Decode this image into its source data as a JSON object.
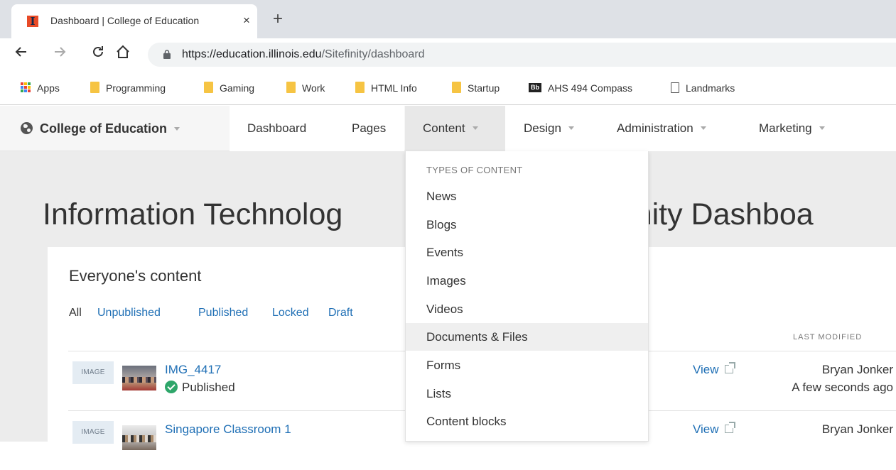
{
  "browser": {
    "tab_title": "Dashboard | College of Education",
    "tab_close": "×",
    "new_tab": "+",
    "url_host": "https://education.illinois.edu",
    "url_path": "/Sitefinity/dashboard"
  },
  "bookmarks": [
    {
      "label": "Apps",
      "icon": "apps-icon"
    },
    {
      "label": "Programming",
      "icon": "folder-icon"
    },
    {
      "label": "Gaming",
      "icon": "folder-icon"
    },
    {
      "label": "Work",
      "icon": "folder-icon"
    },
    {
      "label": "HTML Info",
      "icon": "folder-icon"
    },
    {
      "label": "Startup",
      "icon": "folder-icon"
    },
    {
      "label": "AHS 494 Compass",
      "icon": "blackboard-icon",
      "icon_text": "Bb"
    },
    {
      "label": "Landmarks",
      "icon": "page-icon"
    }
  ],
  "nav": {
    "site_name": "College of Education",
    "items": [
      "Dashboard",
      "Pages",
      "Content",
      "Design",
      "Administration",
      "Marketing"
    ]
  },
  "page": {
    "heading_left": "Information Technolog",
    "heading_right": "tefinity Dashboa"
  },
  "content_panel": {
    "title": "Everyone's content",
    "filters": [
      "All",
      "Unpublished",
      "Published",
      "Locked",
      "Draft"
    ],
    "column_last_modified": "LAST MODIFIED",
    "rows": [
      {
        "type": "IMAGE",
        "title": "IMG_4417",
        "status": "Published",
        "action": "View",
        "owner": "Bryan Jonker",
        "modified": "A few seconds ago"
      },
      {
        "type": "IMAGE",
        "title": "Singapore Classroom 1",
        "status": "",
        "action": "View",
        "owner": "Bryan Jonker",
        "modified": ""
      }
    ]
  },
  "dropdown": {
    "header": "TYPES OF CONTENT",
    "items": [
      "News",
      "Blogs",
      "Events",
      "Images",
      "Videos",
      "Documents & Files",
      "Forms",
      "Lists",
      "Content blocks"
    ],
    "highlighted": "Documents & Files"
  },
  "colors": {
    "link": "#1f6fb5",
    "published": "#2ea66a",
    "illinois_orange": "#e84a27",
    "illinois_blue": "#13294b"
  }
}
